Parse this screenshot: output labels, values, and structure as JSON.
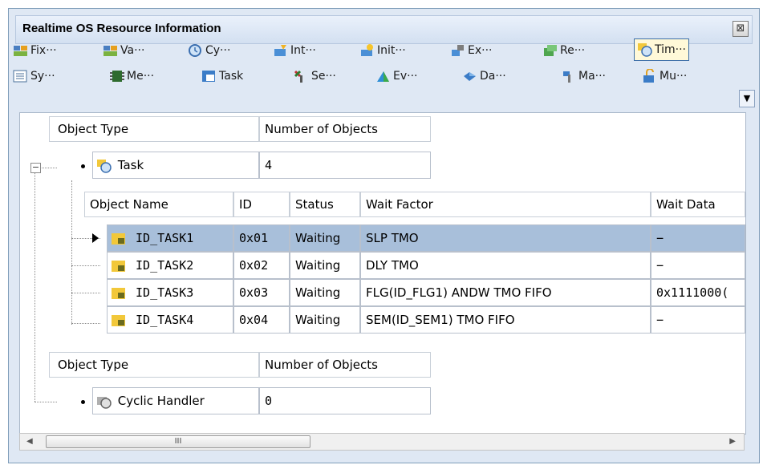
{
  "window": {
    "title": "Realtime OS Resource Information",
    "close_glyph": "⊠"
  },
  "toolbar": {
    "row1": [
      {
        "label": "Fix···",
        "icon": "fixed-memory-icon"
      },
      {
        "label": "Va···",
        "icon": "variable-memory-icon"
      },
      {
        "label": "Cy···",
        "icon": "cyclic-icon"
      },
      {
        "label": "Int···",
        "icon": "interrupt-icon"
      },
      {
        "label": "Init···",
        "icon": "init-icon"
      },
      {
        "label": "Ex···",
        "icon": "exception-icon"
      },
      {
        "label": "Re···",
        "icon": "resource-icon"
      },
      {
        "label": "Tim···",
        "icon": "timer-icon",
        "active": true
      }
    ],
    "row2": [
      {
        "label": "Sy···",
        "icon": "system-icon"
      },
      {
        "label": "Me···",
        "icon": "memory-icon"
      },
      {
        "label": "Task",
        "icon": "task-icon"
      },
      {
        "label": "Se···",
        "icon": "semaphore-icon"
      },
      {
        "label": "Ev···",
        "icon": "event-icon"
      },
      {
        "label": "Da···",
        "icon": "data-queue-icon"
      },
      {
        "label": "Ma···",
        "icon": "mailbox-icon"
      },
      {
        "label": "Mu···",
        "icon": "mutex-icon"
      }
    ],
    "overflow_glyph": "▼"
  },
  "group1": {
    "header": {
      "object_type": "Object Type",
      "number_of_objects": "Number of Objects"
    },
    "type": "Task",
    "count": "4",
    "expander": "−",
    "columns": {
      "name": "Object Name",
      "id": "ID",
      "status": "Status",
      "wait_factor": "Wait Factor",
      "wait_data": "Wait Data"
    },
    "rows": [
      {
        "name": "ID_TASK1",
        "id": "0x01",
        "status": "Waiting",
        "wait_factor": "SLP TMO",
        "wait_data": "−"
      },
      {
        "name": "ID_TASK2",
        "id": "0x02",
        "status": "Waiting",
        "wait_factor": "DLY TMO",
        "wait_data": "−"
      },
      {
        "name": "ID_TASK3",
        "id": "0x03",
        "status": "Waiting",
        "wait_factor": "FLG(ID_FLG1) ANDW TMO FIFO",
        "wait_data": "0x1111000("
      },
      {
        "name": "ID_TASK4",
        "id": "0x04",
        "status": "Waiting",
        "wait_factor": "SEM(ID_SEM1) TMO FIFO",
        "wait_data": "−"
      }
    ]
  },
  "group2": {
    "header": {
      "object_type": "Object Type",
      "number_of_objects": "Number of Objects"
    },
    "type": "Cyclic Handler",
    "count": "0"
  },
  "scrollbar": {
    "left": "◀",
    "right": "▶",
    "grip": "III"
  },
  "colors": {
    "selection": "#a8bfda",
    "window_bg": "#dfe8f4",
    "active_button_bg": "#fff9d8"
  }
}
